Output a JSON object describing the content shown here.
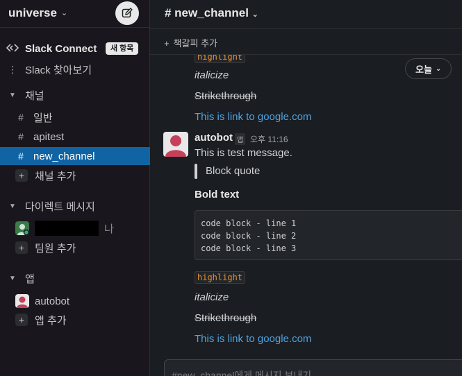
{
  "workspace": {
    "name": "universe",
    "caret": "⌄",
    "compose_icon": "compose-icon"
  },
  "sidebar": {
    "slack_connect": {
      "label": "Slack Connect",
      "badge": "새 항목"
    },
    "browse": {
      "label": "Slack 찾아보기"
    },
    "channels_section": {
      "label": "채널"
    },
    "channels": [
      {
        "label": "일반"
      },
      {
        "label": "apitest"
      },
      {
        "label": "new_channel",
        "active": true
      }
    ],
    "add_channel": "채널 추가",
    "dm_section": {
      "label": "다이렉트 메시지"
    },
    "dm_self_suffix": "나",
    "add_teammate": "팀원 추가",
    "apps_section": {
      "label": "앱"
    },
    "apps": [
      {
        "label": "autobot"
      }
    ],
    "add_app": "앱 추가"
  },
  "channel": {
    "name": "# new_channel",
    "bookmark_add": "책갈피 추가"
  },
  "today_pill": "오늘",
  "messages_top": {
    "highlight": "highlight",
    "italic": "italicize",
    "strike": "Strikethrough",
    "link": "This is link to google.com"
  },
  "message": {
    "sender": "autobot",
    "app_tag": "앱",
    "time": "오후 11:16",
    "text": "This is test message.",
    "quote": "Block quote",
    "bold": "Bold text",
    "code_lines": [
      "code block - line 1",
      "code block - line 2",
      "code block - line 3"
    ],
    "highlight": "highlight",
    "italic": "italicize",
    "strike": "Strikethrough",
    "link": "This is link to google.com"
  },
  "composer": {
    "placeholder": "#new_channel에게 메시지 보내기"
  },
  "colors": {
    "active": "#1164a3",
    "link": "#4fa3e0",
    "highlight": "#e8912d",
    "sidebar_bg": "#19171d"
  }
}
